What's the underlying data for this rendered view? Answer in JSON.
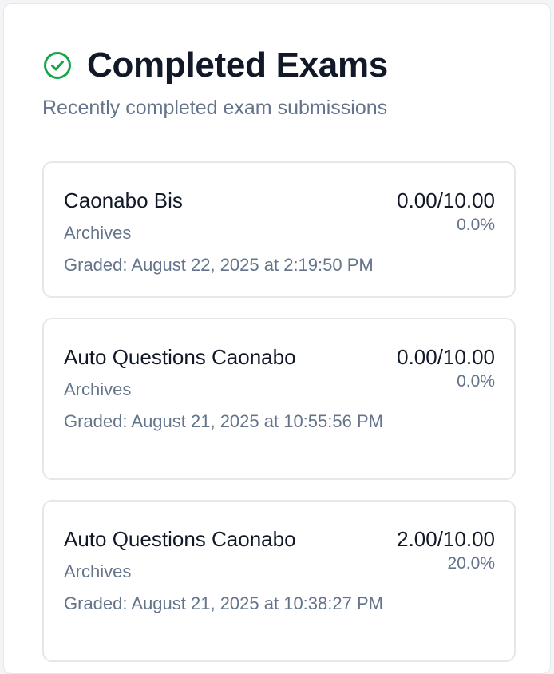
{
  "header": {
    "title": "Completed Exams",
    "subtitle": "Recently completed exam submissions",
    "icon": "check-circle-icon",
    "icon_color": "#16a34a"
  },
  "exams": [
    {
      "name": "Caonabo Bis",
      "course": "Archives",
      "graded": "Graded: August 22, 2025 at 2:19:50 PM",
      "score": "0.00/10.00",
      "percent": "0.0%"
    },
    {
      "name": "Auto Questions Caonabo",
      "course": "Archives",
      "graded": "Graded: August 21, 2025 at 10:55:56 PM",
      "score": "0.00/10.00",
      "percent": "0.0%"
    },
    {
      "name": "Auto Questions Caonabo",
      "course": "Archives",
      "graded": "Graded: August 21, 2025 at 10:38:27 PM",
      "score": "2.00/10.00",
      "percent": "20.0%"
    }
  ]
}
